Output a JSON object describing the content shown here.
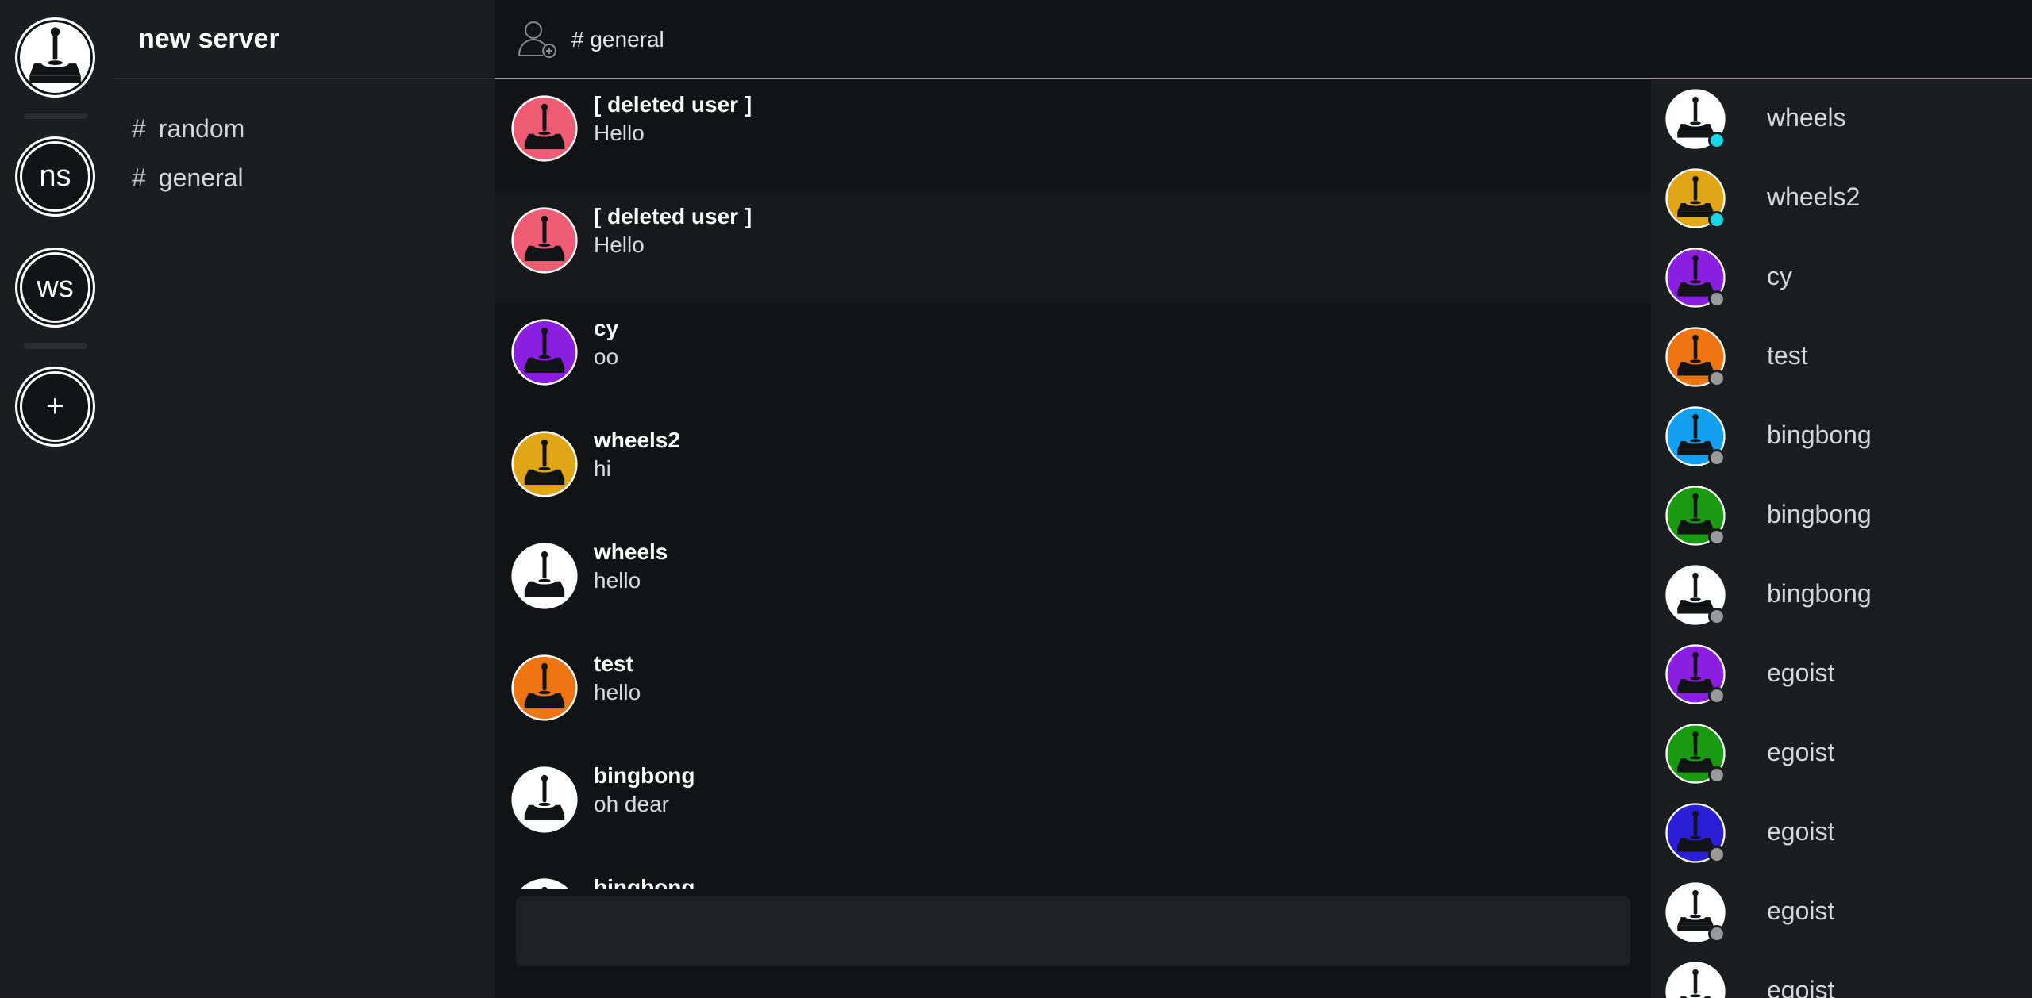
{
  "rail": {
    "servers": [
      {
        "label": "ns"
      },
      {
        "label": "ws"
      }
    ],
    "add_label": "+"
  },
  "sidebar": {
    "server_name": "new server",
    "channels": [
      {
        "hash": "#",
        "name": "random"
      },
      {
        "hash": "#",
        "name": "general"
      }
    ]
  },
  "header": {
    "channel": "# general"
  },
  "messages": [
    {
      "author": "[ deleted user ]",
      "text": "Hello",
      "color": "#f05b74"
    },
    {
      "author": "[ deleted user ]",
      "text": "Hello",
      "color": "#f05b74"
    },
    {
      "author": "cy",
      "text": "oo",
      "color": "#8a1fe0"
    },
    {
      "author": "wheels2",
      "text": "hi",
      "color": "#e0a617"
    },
    {
      "author": "wheels",
      "text": "hello",
      "color": "#ffffff"
    },
    {
      "author": "test",
      "text": "hello",
      "color": "#ee7512"
    },
    {
      "author": "bingbong",
      "text": "oh dear",
      "color": "#ffffff"
    },
    {
      "author": "bingbong",
      "text": "",
      "color": "#ffffff"
    }
  ],
  "composer": {
    "placeholder": ""
  },
  "members": [
    {
      "name": "wheels",
      "color": "#ffffff",
      "status": "online"
    },
    {
      "name": "wheels2",
      "color": "#e0a617",
      "status": "online"
    },
    {
      "name": "cy",
      "color": "#8a1fe0",
      "status": "offline"
    },
    {
      "name": "test",
      "color": "#ee7512",
      "status": "offline"
    },
    {
      "name": "bingbong",
      "color": "#14a0f0",
      "status": "offline"
    },
    {
      "name": "bingbong",
      "color": "#1a9a12",
      "status": "offline"
    },
    {
      "name": "bingbong",
      "color": "#ffffff",
      "status": "offline"
    },
    {
      "name": "egoist",
      "color": "#8a1fe0",
      "status": "offline"
    },
    {
      "name": "egoist",
      "color": "#1a9a12",
      "status": "offline"
    },
    {
      "name": "egoist",
      "color": "#2a1fd6",
      "status": "offline"
    },
    {
      "name": "egoist",
      "color": "#ffffff",
      "status": "offline"
    },
    {
      "name": "egoist",
      "color": "#ffffff",
      "status": "offline"
    }
  ],
  "status_colors": {
    "online": "#19d6e6",
    "offline": "#9a9a9a"
  }
}
